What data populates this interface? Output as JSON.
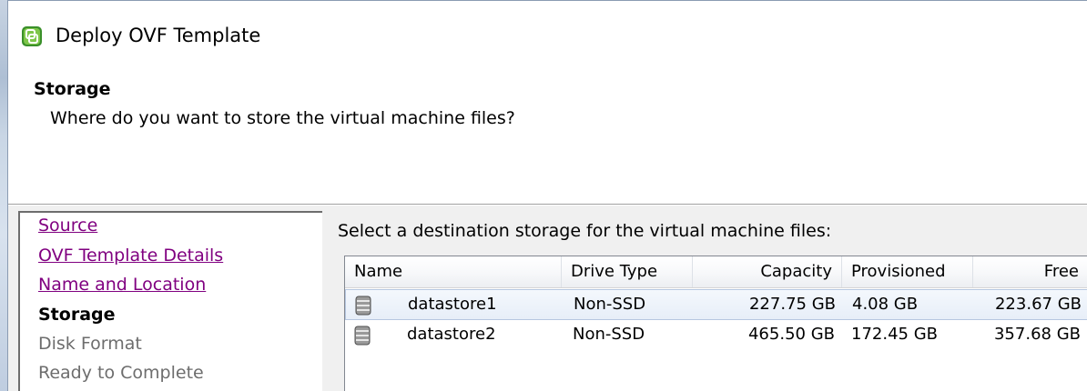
{
  "window": {
    "title": "Deploy OVF Template"
  },
  "header": {
    "step_title": "Storage",
    "step_subtitle": "Where do you want to store the virtual machine files?"
  },
  "nav": {
    "items": [
      {
        "label": "Source",
        "state": "link"
      },
      {
        "label": "OVF Template Details",
        "state": "link"
      },
      {
        "label": "Name and Location",
        "state": "link"
      },
      {
        "label": "Storage",
        "state": "current"
      },
      {
        "label": "Disk Format",
        "state": "disabled"
      },
      {
        "label": "Ready to Complete",
        "state": "disabled"
      }
    ]
  },
  "main": {
    "instruction": "Select a destination storage for the virtual machine files:",
    "table": {
      "columns": [
        "Name",
        "Drive Type",
        "Capacity",
        "Provisioned",
        "Free"
      ],
      "rows": [
        {
          "name": "datastore1",
          "drive_type": "Non-SSD",
          "capacity": "227.75 GB",
          "provisioned": "4.08 GB",
          "free": "223.67 GB",
          "selected": true
        },
        {
          "name": "datastore2",
          "drive_type": "Non-SSD",
          "capacity": "465.50 GB",
          "provisioned": "172.45 GB",
          "free": "357.68 GB",
          "selected": false
        }
      ]
    }
  },
  "icons": {
    "app": "ovf-template-icon",
    "datastore": "datastore-icon"
  },
  "colors": {
    "visited_link": "#800080",
    "disabled_text": "#6d6d6d",
    "selection_border": "#b6c7e0"
  }
}
